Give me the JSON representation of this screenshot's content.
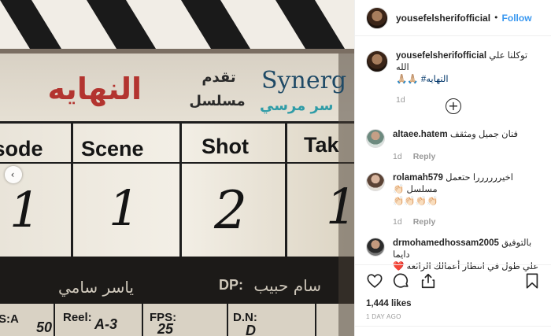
{
  "post": {
    "author": "yousefelsherifofficial",
    "follow_label": "Follow",
    "separator": "•",
    "caption_line1": "توكلنا علي الله",
    "caption_line2_emojis": "🙏🏼🙏🏼",
    "caption_hashtag": "#النهايه",
    "caption_time": "1d",
    "likes": "1,444 likes",
    "date": "1 DAY AGO"
  },
  "comments": [
    {
      "user": "altaee.hatem",
      "text": "فنان جميل ومثقف",
      "time": "1d",
      "reply": "Reply"
    },
    {
      "user": "rolamah579",
      "text": "اخيررررررا حتعمل مسلسل 👏🏻",
      "text2": "👏🏻👏🏻👏🏻👏🏻",
      "time": "1d",
      "reply": "Reply"
    },
    {
      "user": "drmohamedhossam2005",
      "text": "بالتوفيق دايما",
      "text2": "علي طول في انتظار أعمالك الرائعة",
      "heart": "❤️"
    }
  ],
  "clapper": {
    "title_ar": "النهايه",
    "presents_ar": "تقدم",
    "series_ar": "مسلسل",
    "company": "Synerg",
    "company_sub": "سر مرسي",
    "headers": [
      "isode",
      "Scene",
      "Shot",
      "Tak"
    ],
    "values": [
      "1",
      "1",
      "2",
      "1"
    ],
    "director_ar": "ياسر سامي",
    "dp_label": "DP:",
    "dp_ar": "سام حبيب",
    "bottom": [
      "S:A",
      "50",
      "Reel:",
      "A-3",
      "FPS:",
      "25",
      "D.N:",
      "D"
    ]
  },
  "colors": {
    "link": "#3897f0",
    "heart": "#ed4956",
    "red_title": "#b3342f"
  }
}
